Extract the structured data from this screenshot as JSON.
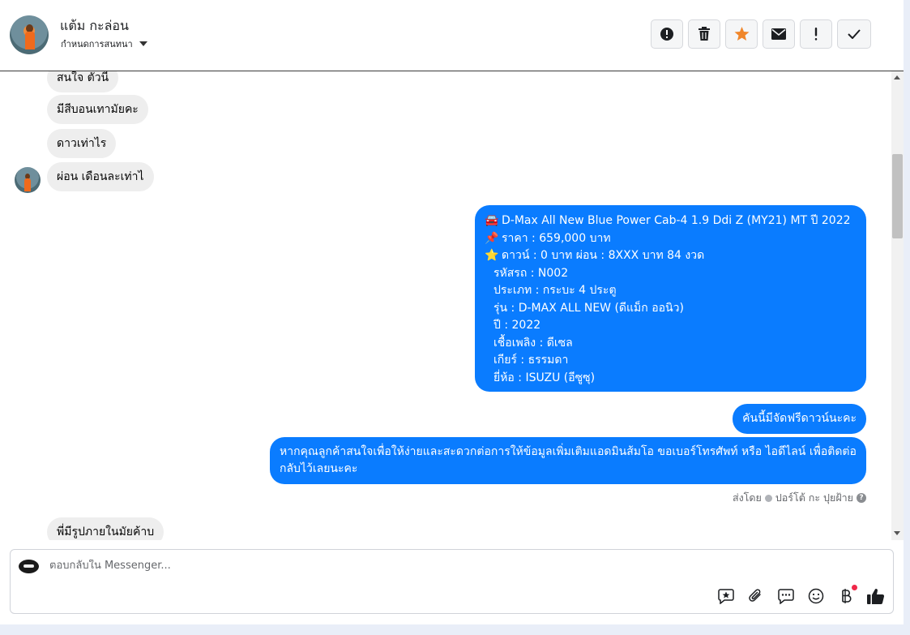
{
  "header": {
    "contact_name": "แต้ม กะล่อน",
    "status_label": "กำหนดการสนทนา"
  },
  "toolbar": {
    "buttons": [
      "alert-circle-icon",
      "trash-icon",
      "star-icon",
      "envelope-icon",
      "exclamation-icon",
      "check-icon"
    ]
  },
  "messages_in": [
    "สนใจ ตัวนี",
    "มีสีบอนเทามัยคะ",
    "ดาวเท่าไร",
    "ผ่อน เดือนละเท่าไ",
    "พี่มีรูปภายในมัยค้าบ"
  ],
  "car_card": {
    "line1": "D-Max All New Blue Power Cab-4 1.9 Ddi Z (MY21) MT ปี 2022",
    "line2": "ราคา : 659,000 บาท",
    "line3": "ดาวน์ : 0 บาท ผ่อน : 8XXX บาท 84 งวด",
    "line4": "รหัสรถ : N002",
    "line5": "ประเภท : กระบะ 4 ประตู",
    "line6": "รุ่น : D-MAX ALL NEW (ดีแม็ก ออนิว)",
    "line7": "ปี : 2022",
    "line8": "เชื้อเพลิง : ดีเซล",
    "line9": "เกียร์ : ธรรมดา",
    "line10": "ยี่ห้อ : ISUZU (อีซูซุ)",
    "emoji1": "🚘",
    "emoji2": "📌",
    "emoji3": "⭐"
  },
  "messages_out": [
    "คันนี้มีจัดฟรีดาวน์นะคะ",
    "หากคุณลูกค้าสนใจเพื่อให้ง่ายและสะดวกต่อการให้ข้อมูลเพิ่มเติมแอดมินส้มโอ ขอเบอร์โทรศัพท์ หรือ ไอดีไลน์ เพื่อติดต่อกลับไว้เลยนะคะ"
  ],
  "sent_by": {
    "prefix": "ส่งโดย",
    "agent": "ปอร์โต้ กะ ปุยฝ้าย"
  },
  "composer": {
    "placeholder": "ตอบกลับใน Messenger..."
  },
  "colors": {
    "outgoing": "#0a7cff",
    "incoming": "#eeeeee",
    "star": "#f0862a"
  }
}
